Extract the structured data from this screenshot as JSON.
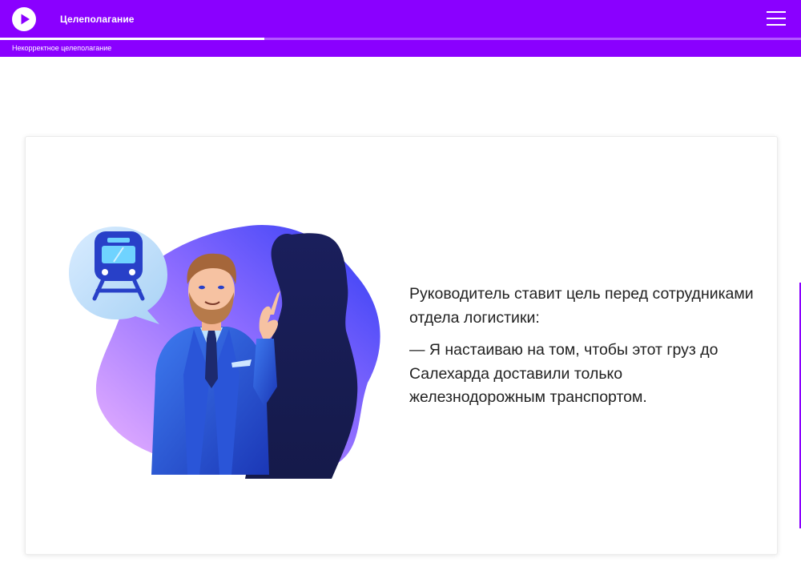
{
  "header": {
    "course_title": "Целеполагание",
    "lesson_title": "Некорректное целеполагание",
    "progress": 0.33,
    "play_icon": "play-icon",
    "menu_icon": "hamburger-menu-icon",
    "accent_color": "#8a00ff"
  },
  "card": {
    "paragraph_1": "Руководитель ставит цель перед сотрудниками отдела логистики:",
    "paragraph_2": "— Я настаиваю на том, чтобы этот груз до Салехарда доставили только железнодорожным транспортом.",
    "illustration": {
      "speech_bubble_icon": "train-icon",
      "description_icons": [
        "manager-figure",
        "employee-silhouette"
      ]
    }
  }
}
